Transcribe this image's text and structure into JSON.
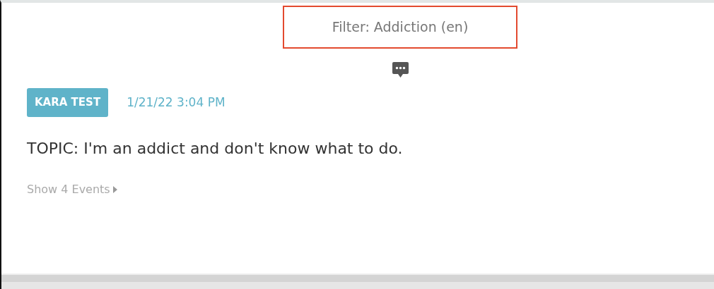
{
  "filter": {
    "label": "Filter: Addiction (en)"
  },
  "post": {
    "author": "KARA TEST",
    "timestamp": "1/21/22 3:04 PM",
    "topic": "TOPIC: I'm an addict and don't know what to do.",
    "events_link": "Show 4 Events",
    "events_expanded": false
  }
}
